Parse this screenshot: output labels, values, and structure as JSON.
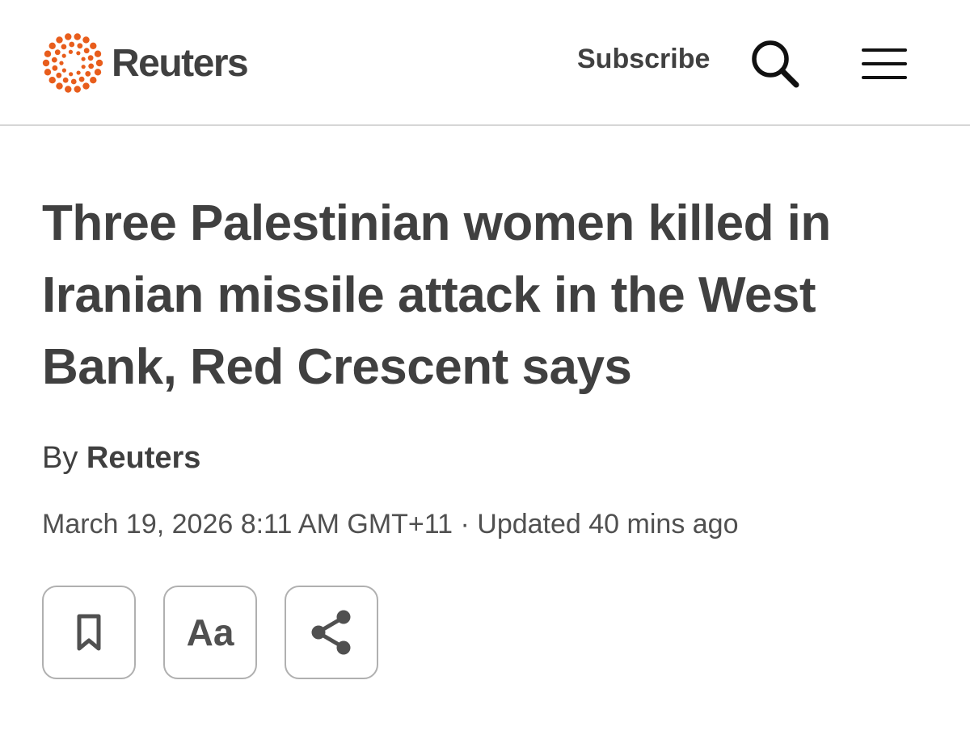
{
  "header": {
    "logo_text": "Reuters",
    "subscribe_label": "Subscribe",
    "search_icon": "search-icon",
    "menu_icon": "hamburger-menu-icon",
    "brand_color": "#e85d1c"
  },
  "article": {
    "headline_lines": [
      "Three Palestinian women killed in",
      "Iranian missile attack in the West",
      "Bank, Red Crescent says"
    ],
    "byline_prefix": "By",
    "byline_author": "Reuters",
    "dateline": "March 19, 2026 8:11 AM GMT+11 · Updated 40 mins ago"
  },
  "actions": {
    "bookmark_icon": "bookmark-icon",
    "text_size_label": "Aa",
    "share_icon": "share-icon"
  }
}
